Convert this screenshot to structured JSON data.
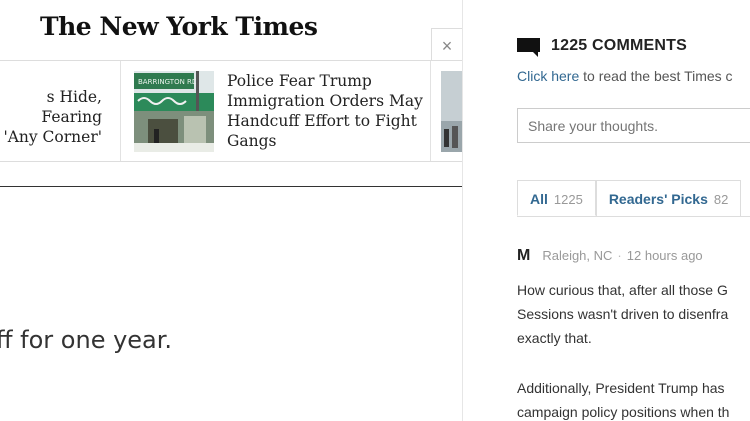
{
  "site": {
    "logo": "The New York Times",
    "close_glyph": "×"
  },
  "related": [
    {
      "headline": "s Hide, Fearing\n'Any Corner'"
    },
    {
      "headline": "Police Fear Trump\nImmigration Orders May\nHandcuff Effort to Fight\nGangs",
      "thumb_sign": "BARRINGTON RD"
    }
  ],
  "article": {
    "fragment": "ff for one year."
  },
  "comments": {
    "title": "1225 COMMENTS",
    "sub_link": "Click here",
    "sub_rest": " to read the best Times c",
    "placeholder": "Share your thoughts.",
    "tabs": [
      {
        "label": "All",
        "count": "1225"
      },
      {
        "label": "Readers' Picks",
        "count": "82"
      }
    ],
    "first": {
      "initial": "M",
      "location": "Raleigh, NC",
      "separator": "·",
      "time": "12 hours ago",
      "paragraph1": "How curious that, after all those G\nSessions wasn't driven to disenfra\nexactly that.",
      "paragraph2": "Additionally, President Trump has \ncampaign policy positions when th"
    }
  },
  "colors": {
    "link": "#326891",
    "text": "#333333",
    "muted": "#999999",
    "border": "#dddddd"
  }
}
